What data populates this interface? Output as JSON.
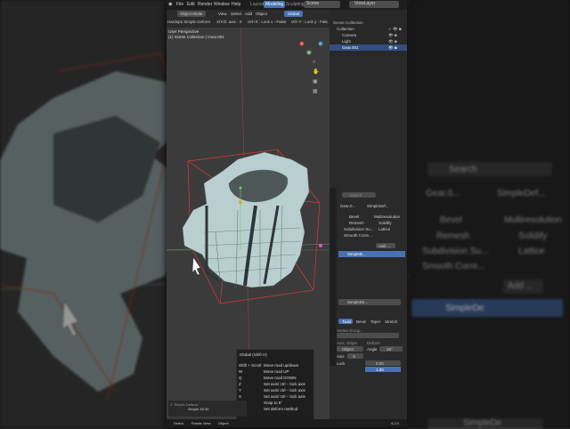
{
  "top_menu": [
    "File",
    "Edit",
    "Render",
    "Window",
    "Help"
  ],
  "workspace_tabs": [
    "Layout",
    "Modeling",
    "Sculpting"
  ],
  "active_tab": "Modeling",
  "scene_name": "Scene",
  "view_layer": "ViewLayer",
  "viewport": {
    "mode": "Object Mode",
    "menus": [
      "View",
      "Select",
      "Add",
      "Object"
    ],
    "transform_orientation": "Global",
    "tool_header": "Hardops Simple Deform",
    "xyz_hint": "X/Y/Z: axis - X",
    "ctrlx_hint": "ctrl+X : Lock x - False",
    "ctrly_hint": "ctrl+Y : Lock y - Fals",
    "perspective": "User Perspective",
    "collection_path": "(1) Scene Collection | Gear.001",
    "nav_axis_x": "X",
    "nav_axis_y": "Y",
    "nav_axis_z": "Z"
  },
  "shortcut_popup": {
    "title": "Global (Shift H)",
    "rows": [
      {
        "key": "Shift + Scroll",
        "action": "Move mod up/down"
      },
      {
        "key": "W",
        "action": "Move mod UP"
      },
      {
        "key": "Q",
        "action": "Move mod DOWN"
      },
      {
        "key": "Z",
        "action": "Set axis/ ctrl – lock axis"
      },
      {
        "key": "Y",
        "action": "Set axis/ ctrl – lock axis"
      },
      {
        "key": "X",
        "action": "Set axis/ ctrl – lock axis"
      },
      {
        "key": "Ctrl",
        "action": "Snap to 5°"
      },
      {
        "key": "",
        "action": "Set deform method"
      }
    ]
  },
  "bottom_overlay": {
    "line1": "1. Simple Deform",
    "line2": "Simple 45.00"
  },
  "outliner": {
    "title": "Scene Collection",
    "items": [
      {
        "label": "Collection",
        "indent": 0
      },
      {
        "label": "Camera",
        "indent": 1
      },
      {
        "label": "Light",
        "indent": 1
      },
      {
        "label": "Gear.001",
        "indent": 1,
        "selected": true
      }
    ]
  },
  "properties": {
    "search_placeholder": "Search",
    "object_name": "Gear.0...",
    "modifier_name": "SimpleDef...",
    "add_modifier_menu": [
      {
        "left": "Bevel",
        "right": "Multiresolution"
      },
      {
        "left": "Remesh",
        "right": "Solidify"
      },
      {
        "left": "Subdivision Su...",
        "right": "Lattice"
      },
      {
        "left": "Smooth Corre...",
        "right": ""
      }
    ],
    "add_label": "Add ...",
    "stack_item": "SimpleD...",
    "modifier_panel_name": "SimpleDe...",
    "deform_types": [
      "Twist",
      "Bend",
      "Taper",
      "Stretch"
    ],
    "active_deform": "Twist",
    "vertex_group_label": "Vertex Group",
    "origin_label": "Axis, Origin",
    "deform_label": "Deform",
    "origin_value": "Object",
    "angle_label": "Angle",
    "angle_value": "45°",
    "axis_label": "Axis",
    "axis_value": "X",
    "lock_label": "Lock",
    "limits_min": "0.00",
    "limits_max": "1.00",
    "version": "4.2.0"
  },
  "background_zoom": {
    "search_placeholder": "Search",
    "object_name": "Gear.0...",
    "modifier_name": "SimpleDef...",
    "menu": [
      {
        "left": "Bevel",
        "right": "Multiresolution"
      },
      {
        "left": "Remesh",
        "right": "Solidify"
      },
      {
        "left": "Subdivision Su...",
        "right": "Lattice"
      },
      {
        "left": "Smooth Corre...",
        "right": ""
      }
    ],
    "add_label": "Add ...",
    "stack_item": "SimpleDe",
    "stack_item_bottom": "SimpleDe"
  },
  "status_bar": {
    "select": "Select",
    "rotate": "Rotate View",
    "object": "Object"
  },
  "colors": {
    "accent_blue": "#4772b3",
    "bbox_red": "#d63a3a",
    "mesh_face": "#b9cfcf",
    "mesh_wire": "#5d6f72"
  }
}
